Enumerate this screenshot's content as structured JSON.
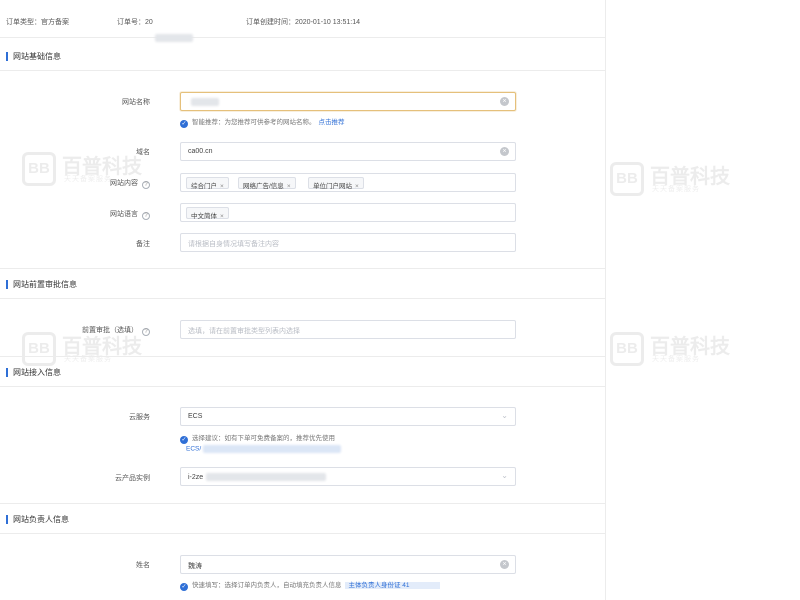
{
  "order": {
    "type_label": "订单类型：官方备案",
    "number_label": "订单号：20",
    "created_label": "订单创建时间：2020-01-10 13:51:14"
  },
  "section_basic": {
    "title": "网站基础信息",
    "site_name": {
      "label": "网站名称",
      "hint": "智能推荐：为您推荐可供参考的网站名称。",
      "hint_link": "点击推荐"
    },
    "domain": {
      "label": "域名",
      "value": "ca00.cn"
    },
    "content": {
      "label": "网站内容",
      "tags": [
        "综合门户",
        "网络广告/信息",
        "单位门户网站"
      ]
    },
    "language": {
      "label": "网站语言",
      "tags": [
        "中文简体"
      ]
    },
    "remark": {
      "label": "备注",
      "placeholder": "请根据自身情况填写备注内容"
    }
  },
  "section_approval": {
    "title": "网站前置审批信息",
    "pre_approval": {
      "label": "前置审批（选填）",
      "placeholder": "选填，请在前置审批类型列表内选择"
    }
  },
  "section_access": {
    "title": "网站接入信息",
    "provider": {
      "label": "云服务",
      "value": "ECS",
      "hint": "选择建议：如有下单可免费备案的，推荐优先使用",
      "hint_link": "ECS/"
    },
    "instance": {
      "label": "云产品实例",
      "value": "i-2ze"
    }
  },
  "section_owner": {
    "title": "网站负责人信息",
    "name": {
      "label": "姓名",
      "value": "魏涛",
      "hint": "快速填写：选择订单内负责人，自动填充负责人信息",
      "hint_link": "主体负责人身份证 41"
    }
  },
  "watermark": {
    "name": "百普科技",
    "sub": "天天备案服务",
    "logo": "BB"
  },
  "icons": {
    "clear": "clear-icon",
    "help": "help-icon",
    "info": "info-icon",
    "dropdown": "chevron-down-icon",
    "tag_remove": "close-icon"
  },
  "colors": {
    "accent": "#2f6fd6",
    "focus_border": "#e5c07b"
  }
}
